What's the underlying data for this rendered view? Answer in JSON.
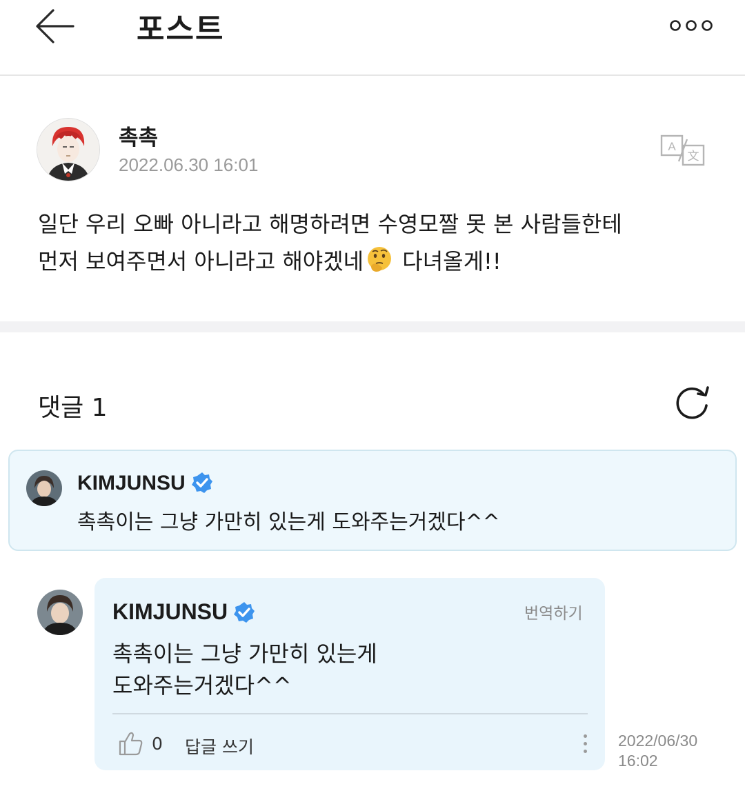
{
  "header": {
    "title": "포스트",
    "back_icon": "arrow-left-icon",
    "more_icon": "more-dots-icon"
  },
  "post": {
    "author": "촉촉",
    "date": "2022.06.30 16:01",
    "translate_icon": "translate-icon",
    "body_line1": "일단 우리 오빠 아니라고 해명하려면 수영모짤 못 본 사람들한테",
    "body_line2_before": "먼저 보여주면서 아니라고 해야겠네",
    "body_emoji": "thinking-face-emoji",
    "body_line2_after": " 다녀올게!!"
  },
  "comments": {
    "title": "댓글 1",
    "refresh_icon": "refresh-icon"
  },
  "pinned_comment": {
    "author": "KIMJUNSU",
    "verified_icon": "verified-badge-icon",
    "text": "촉촉이는 그냥 가만히 있는게 도와주는거겠다^^"
  },
  "reply_comment": {
    "author": "KIMJUNSU",
    "verified_icon": "verified-badge-icon",
    "translate_label": "번역하기",
    "text_line1": "촉촉이는 그냥 가만히 있는게",
    "text_line2": "도와주는거겠다^^",
    "like_icon": "thumbs-up-icon",
    "like_count": "0",
    "reply_label": "답글 쓰기",
    "menu_icon": "kebab-menu-icon",
    "date_line1": "2022/06/30",
    "date_line2": "16:02"
  },
  "colors": {
    "card_bg": "#e9f5fc",
    "pinned_bg": "#eef8fd",
    "pinned_border": "#cfe6ef",
    "verified_blue": "#3d94ee",
    "muted_text": "#9a9a9a"
  }
}
